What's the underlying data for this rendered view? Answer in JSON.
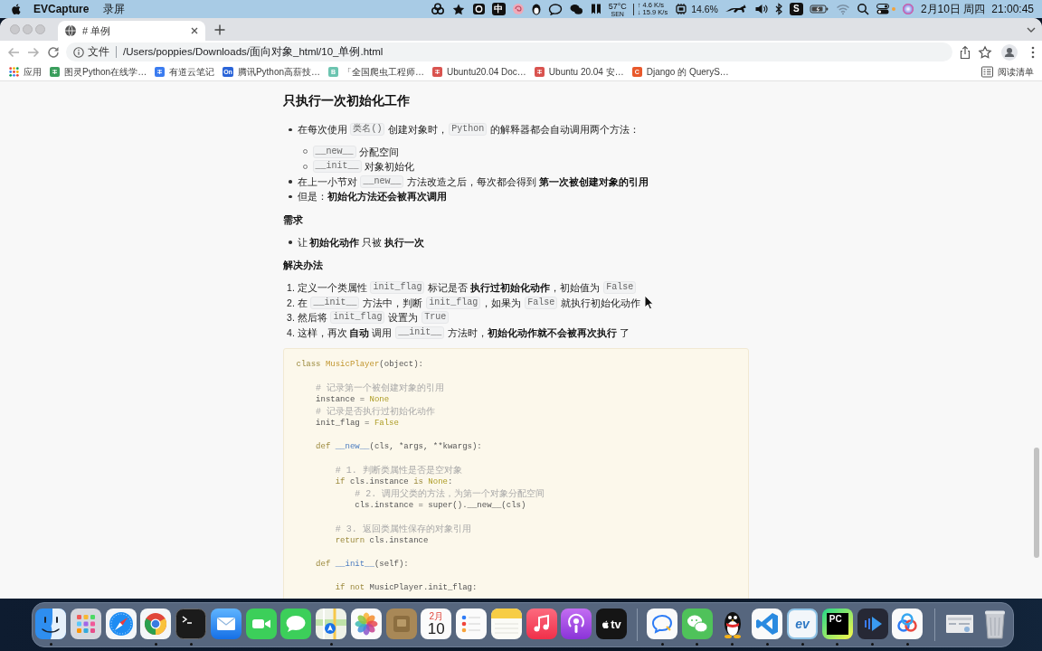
{
  "menu_bar": {
    "app_name": "EVCapture",
    "menus": [
      "录屏"
    ],
    "ime_badge": "中",
    "temperature": "57°C",
    "sensor": "SEN",
    "upload": "↑ 4.6 K/s",
    "download": "↓ 15.9 K/s",
    "cpu_usage": "14.6%",
    "keyboard_badge": "S",
    "date": "2月10日 周四",
    "time": "21:00:45"
  },
  "browser": {
    "tabs": [
      {
        "title": "# 单例",
        "selected": true
      }
    ],
    "address": {
      "label": "文件",
      "url": "/Users/poppies/Downloads/面向对象_html/10_单例.html"
    },
    "bookmarks": [
      {
        "kind": "apps",
        "label": "应用"
      },
      {
        "kind": "favicon",
        "label": "图灵Python在线学…",
        "color": "#3a9e5c"
      },
      {
        "kind": "favicon",
        "label": "有道云笔记",
        "color": "#3b7cf0"
      },
      {
        "kind": "favicon",
        "label": "腾讯Python高薪技…",
        "color": "#2a64d8",
        "badge": "On"
      },
      {
        "kind": "favicon",
        "label": "「全国爬虫工程师…",
        "color": "#6cc4b0",
        "badge": "B"
      },
      {
        "kind": "favicon",
        "label": "Ubuntu20.04 Doc…",
        "color": "#d9534f"
      },
      {
        "kind": "favicon",
        "label": "Ubuntu 20.04 安…",
        "color": "#d9534f"
      },
      {
        "kind": "favicon",
        "label": "Django 的 QueryS…",
        "color": "#e8582b",
        "badge": "C"
      }
    ],
    "reading_list": "阅读清单"
  },
  "document": {
    "blocks": [
      {
        "kind": "heading",
        "text": "只执行一次初始化工作"
      },
      {
        "kind": "bullets",
        "items": [
          {
            "segments": [
              {
                "kind": "text",
                "text": "在每次使用 "
              },
              {
                "kind": "code",
                "text": "类名()"
              },
              {
                "kind": "text",
                "text": " 创建对象时，"
              },
              {
                "kind": "code",
                "text": "Python"
              },
              {
                "kind": "text",
                "text": " 的解释器都会自动调用两个方法："
              }
            ],
            "children": [
              {
                "segments": [
                  {
                    "kind": "code",
                    "text": "__new__"
                  },
                  {
                    "kind": "text",
                    "text": " 分配空间"
                  }
                ]
              },
              {
                "segments": [
                  {
                    "kind": "code",
                    "text": "__init__"
                  },
                  {
                    "kind": "text",
                    "text": " 对象初始化"
                  }
                ]
              }
            ]
          },
          {
            "segments": [
              {
                "kind": "text",
                "text": "在上一小节对 "
              },
              {
                "kind": "code",
                "text": "__new__"
              },
              {
                "kind": "text",
                "text": " 方法改造之后，每次都会得到 "
              },
              {
                "kind": "bold",
                "text": "第一次被创建对象的引用"
              }
            ]
          },
          {
            "segments": [
              {
                "kind": "text",
                "text": "但是："
              },
              {
                "kind": "bold",
                "text": "初始化方法还会被再次调用"
              }
            ]
          }
        ]
      },
      {
        "kind": "subheading",
        "text": "需求"
      },
      {
        "kind": "bullets",
        "items": [
          {
            "segments": [
              {
                "kind": "text",
                "text": "让 "
              },
              {
                "kind": "bold",
                "text": "初始化动作"
              },
              {
                "kind": "text",
                "text": " 只被 "
              },
              {
                "kind": "bold",
                "text": "执行一次"
              }
            ]
          }
        ]
      },
      {
        "kind": "subheading",
        "text": "解决办法"
      },
      {
        "kind": "numbered",
        "items": [
          {
            "marker": "1.",
            "segments": [
              {
                "kind": "text",
                "text": "定义一个类属性 "
              },
              {
                "kind": "code",
                "text": "init_flag"
              },
              {
                "kind": "text",
                "text": " 标记是否 "
              },
              {
                "kind": "bold",
                "text": "执行过初始化动作"
              },
              {
                "kind": "text",
                "text": "，初始值为 "
              },
              {
                "kind": "code",
                "text": "False"
              }
            ]
          },
          {
            "marker": "2.",
            "segments": [
              {
                "kind": "text",
                "text": "在 "
              },
              {
                "kind": "code",
                "text": "__init__"
              },
              {
                "kind": "text",
                "text": " 方法中，判断 "
              },
              {
                "kind": "code",
                "text": "init_flag"
              },
              {
                "kind": "text",
                "text": "，如果为 "
              },
              {
                "kind": "code",
                "text": "False"
              },
              {
                "kind": "text",
                "text": " 就执行初始化动作"
              }
            ]
          },
          {
            "marker": "3.",
            "segments": [
              {
                "kind": "text",
                "text": "然后将 "
              },
              {
                "kind": "code",
                "text": "init_flag"
              },
              {
                "kind": "text",
                "text": " 设置为 "
              },
              {
                "kind": "code",
                "text": "True"
              }
            ]
          },
          {
            "marker": "4.",
            "segments": [
              {
                "kind": "text",
                "text": "这样，再次 "
              },
              {
                "kind": "bold",
                "text": "自动"
              },
              {
                "kind": "text",
                "text": " 调用 "
              },
              {
                "kind": "code",
                "text": "__init__"
              },
              {
                "kind": "text",
                "text": " 方法时，"
              },
              {
                "kind": "bold",
                "text": "初始化动作就不会被再次执行"
              },
              {
                "kind": "text",
                "text": " 了"
              }
            ]
          }
        ]
      },
      {
        "kind": "code",
        "groups": [
          {
            "lines": [
              {
                "tokens": [
                  {
                    "kind": "keyword",
                    "text": "class"
                  },
                  {
                    "kind": "class",
                    "text": " MusicPlayer"
                  },
                  {
                    "kind": "plain",
                    "text": "(object):"
                  }
                ]
              }
            ]
          },
          {
            "lines": [
              {
                "tokens": [
                  {
                    "kind": "comment",
                    "text": "    # 记录第一个被创建对象的引用"
                  }
                ]
              },
              {
                "tokens": [
                  {
                    "kind": "plain",
                    "text": "    instance = "
                  },
                  {
                    "kind": "const",
                    "text": "None"
                  }
                ]
              },
              {
                "tokens": [
                  {
                    "kind": "comment",
                    "text": "    # 记录是否执行过初始化动作"
                  }
                ]
              },
              {
                "tokens": [
                  {
                    "kind": "plain",
                    "text": "    init_flag = "
                  },
                  {
                    "kind": "const",
                    "text": "False"
                  }
                ]
              }
            ]
          },
          {
            "lines": [
              {
                "tokens": [
                  {
                    "kind": "keyword",
                    "text": "    def"
                  },
                  {
                    "kind": "func",
                    "text": " __new__"
                  },
                  {
                    "kind": "plain",
                    "text": "(cls, *args, **kwargs):"
                  }
                ]
              }
            ]
          },
          {
            "lines": [
              {
                "tokens": [
                  {
                    "kind": "comment",
                    "text": "        # 1. 判断类属性是否是空对象"
                  }
                ]
              },
              {
                "tokens": [
                  {
                    "kind": "keyword",
                    "text": "        if"
                  },
                  {
                    "kind": "plain",
                    "text": " cls.instance "
                  },
                  {
                    "kind": "keyword",
                    "text": "is"
                  },
                  {
                    "kind": "const",
                    "text": " None"
                  },
                  {
                    "kind": "plain",
                    "text": ":"
                  }
                ]
              },
              {
                "tokens": [
                  {
                    "kind": "comment",
                    "text": "            # 2. 调用父类的方法，为第一个对象分配空间"
                  }
                ]
              },
              {
                "tokens": [
                  {
                    "kind": "plain",
                    "text": "            cls.instance = super().__new__(cls)"
                  }
                ]
              }
            ]
          },
          {
            "lines": [
              {
                "tokens": [
                  {
                    "kind": "comment",
                    "text": "        # 3. 返回类属性保存的对象引用"
                  }
                ]
              },
              {
                "tokens": [
                  {
                    "kind": "keyword",
                    "text": "        return"
                  },
                  {
                    "kind": "plain",
                    "text": " cls.instance"
                  }
                ]
              }
            ]
          },
          {
            "lines": [
              {
                "tokens": [
                  {
                    "kind": "keyword",
                    "text": "    def"
                  },
                  {
                    "kind": "func",
                    "text": " __init__"
                  },
                  {
                    "kind": "plain",
                    "text": "(self):"
                  }
                ]
              }
            ]
          },
          {
            "lines": [
              {
                "tokens": [
                  {
                    "kind": "keyword",
                    "text": "        if not"
                  },
                  {
                    "kind": "plain",
                    "text": " MusicPlayer.init_flag:"
                  }
                ]
              }
            ]
          }
        ]
      }
    ]
  },
  "dock": {
    "groups": [
      {
        "items": [
          {
            "kind": "finder",
            "running": true
          },
          {
            "kind": "launchpad",
            "running": false
          },
          {
            "kind": "safari",
            "running": false
          },
          {
            "kind": "chrome",
            "running": true
          },
          {
            "kind": "terminal",
            "running": true
          },
          {
            "kind": "mail",
            "running": false
          },
          {
            "kind": "facetime",
            "running": false
          },
          {
            "kind": "messages",
            "running": false
          },
          {
            "kind": "maps",
            "running": true
          },
          {
            "kind": "photos",
            "running": false
          },
          {
            "kind": "tile",
            "running": false
          },
          {
            "kind": "calendar",
            "month": "2月",
            "day": "10",
            "running": false
          },
          {
            "kind": "reminders",
            "running": false
          },
          {
            "kind": "notes",
            "running": false
          },
          {
            "kind": "music",
            "running": false
          },
          {
            "kind": "podcasts",
            "running": false
          },
          {
            "kind": "tv",
            "label": "tv",
            "running": false
          }
        ]
      },
      {
        "items": [
          {
            "kind": "chat",
            "running": true
          },
          {
            "kind": "wechat",
            "running": true
          },
          {
            "kind": "penguin",
            "running": true
          },
          {
            "kind": "editor",
            "running": true
          },
          {
            "kind": "ev",
            "label": "ev",
            "running": true
          },
          {
            "kind": "pycharm",
            "label": "PC",
            "running": true
          },
          {
            "kind": "player",
            "running": true
          },
          {
            "kind": "rings",
            "running": true
          }
        ]
      },
      {
        "items": [
          {
            "kind": "screenshot",
            "running": false
          },
          {
            "kind": "trash",
            "running": false
          }
        ]
      }
    ]
  }
}
